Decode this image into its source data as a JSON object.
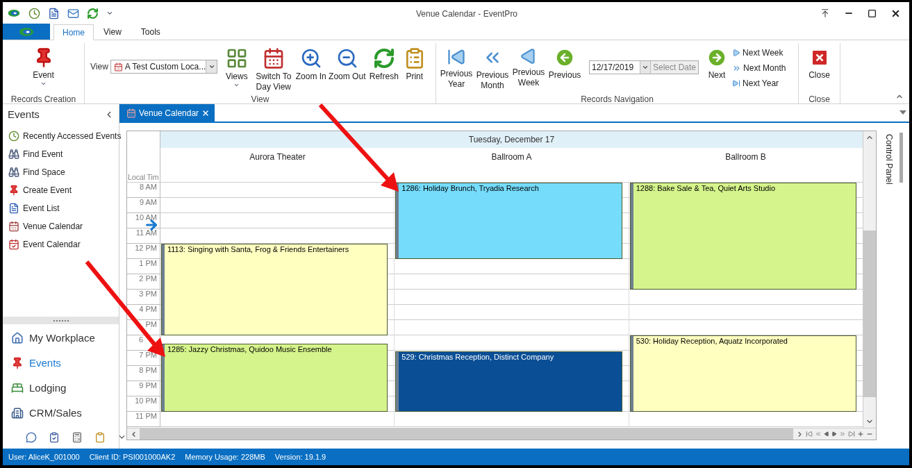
{
  "window": {
    "title": "Venue Calendar - EventPro"
  },
  "ribbon_tabs": [
    {
      "label": "Home",
      "selected": true
    },
    {
      "label": "View",
      "selected": false
    },
    {
      "label": "Tools",
      "selected": false
    }
  ],
  "ribbon": {
    "records_creation": {
      "caption": "Records Creation",
      "event_button": {
        "label": "Event",
        "dropdown": true
      }
    },
    "view": {
      "caption": "View",
      "combo_label": "View",
      "combo_value": "A Test Custom Loca...",
      "buttons": [
        {
          "label": "Views",
          "dropdown": true
        },
        {
          "label": "Switch To\nDay View",
          "dropdown": false
        },
        {
          "label": "Zoom In",
          "dropdown": false
        },
        {
          "label": "Zoom Out",
          "dropdown": false
        },
        {
          "label": "Refresh",
          "dropdown": false
        },
        {
          "label": "Print",
          "dropdown": false
        }
      ]
    },
    "navigation": {
      "caption": "Records Navigation",
      "prev_buttons": [
        "Previous\nYear",
        "Previous\nMonth",
        "Previous\nWeek",
        "Previous"
      ],
      "date_value": "12/17/2019",
      "select_date": "Select Date",
      "next_button": "Next",
      "next_links": [
        "Next Week",
        "Next Month",
        "Next Year"
      ]
    },
    "close": {
      "caption": "Close",
      "button": "Close"
    }
  },
  "events_pane": {
    "title": "Events",
    "items": [
      "Recently Accessed Events",
      "Find Event",
      "Find Space",
      "Create Event",
      "Event List",
      "Venue Calendar",
      "Event Calendar"
    ]
  },
  "nav_buttons": [
    {
      "label": "My Workplace",
      "selected": false
    },
    {
      "label": "Events",
      "selected": true
    },
    {
      "label": "Lodging",
      "selected": false
    },
    {
      "label": "CRM/Sales",
      "selected": false
    }
  ],
  "document_tabs": [
    {
      "label": "Venue Calendar",
      "selected": true
    }
  ],
  "calendar": {
    "date": "Tuesday, December 17",
    "time_header": "Local Tim",
    "hours": [
      "8 AM",
      "9 AM",
      "10 AM",
      "11 AM",
      "12 PM",
      "1 PM",
      "2 PM",
      "3 PM",
      "4 PM",
      "PM",
      "6",
      "7 PM",
      "8 PM",
      "9 PM",
      "10 PM",
      "11 PM"
    ],
    "resources": [
      {
        "name": "Aurora Theater",
        "events": [
          {
            "title": "1113: Singing with Santa, Frog & Friends Entertainers",
            "color": "#ffffc0"
          },
          {
            "title": "1285: Jazzy Christmas, Quidoo Music Ensemble",
            "color": "#d5f48c"
          }
        ]
      },
      {
        "name": "Ballroom A",
        "events": [
          {
            "title": "1286: Holiday Brunch, Tryadia Research",
            "color": "#75dcfc"
          },
          {
            "title": "529: Christmas Reception, Distinct Company",
            "color": "#0a4f96"
          }
        ]
      },
      {
        "name": "Ballroom B",
        "events": [
          {
            "title": "1288: Bake Sale & Tea, Quiet Arts Studio",
            "color": "#d5f48c"
          },
          {
            "title": "530: Holiday Reception, Aquatz Incorporated",
            "color": "#ffffc0"
          }
        ]
      }
    ]
  },
  "control_panel": "Control Panel",
  "status_bar": [
    "User: AliceK_001000",
    "Client ID: PSI001000AK2",
    "Memory Usage: 228MB",
    "Version: 19.1.9"
  ]
}
